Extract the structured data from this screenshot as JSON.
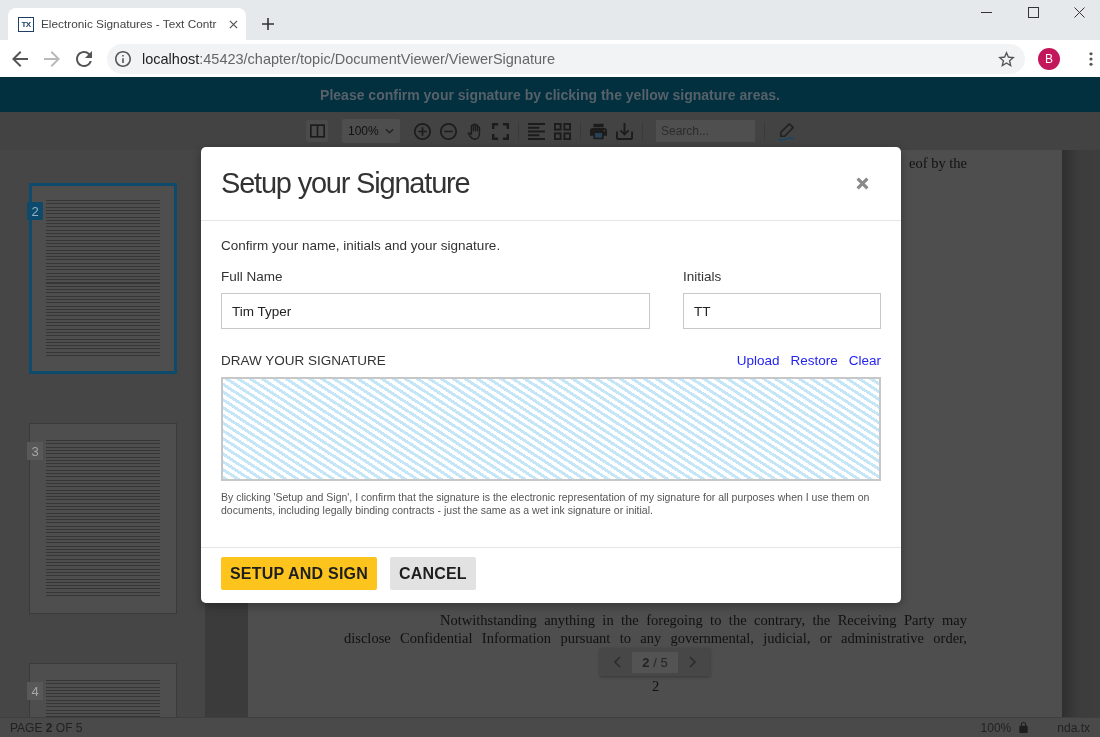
{
  "browser": {
    "tab": {
      "icon_text": "TX",
      "title": "Electronic Signatures - Text Contr",
      "selected": true
    },
    "address": {
      "host": "localhost",
      "path": ":45423/chapter/topic/DocumentViewer/ViewerSignature"
    },
    "profile": {
      "initial": "B"
    }
  },
  "banner": {
    "text": "Please confirm your signature by clicking the yellow signature areas."
  },
  "toolbar": {
    "zoom": "100%",
    "search": {
      "placeholder": "Search..."
    }
  },
  "thumbnails": [
    {
      "page": "2",
      "selected": true
    },
    {
      "page": "3",
      "selected": false
    },
    {
      "page": "4",
      "selected": false
    }
  ],
  "document": {
    "top_text": "eof by the",
    "paragraph": "Notwithstanding anything in the foregoing to the contrary, the Receiving Party may disclose Confidential Information pursuant to any governmental, judicial, or administrative order,",
    "page_number": "2"
  },
  "pager": {
    "label": "**2** / 5"
  },
  "dialog": {
    "title": "Setup your Signature",
    "intro": "Confirm your name, initials and your signature.",
    "fields": [
      {
        "label": "Full Name",
        "value": "Tim Typer"
      },
      {
        "label": "Initials",
        "value": "TT"
      }
    ],
    "signature": {
      "label": "DRAW YOUR SIGNATURE",
      "links": [
        "Upload",
        "Restore",
        "Clear"
      ]
    },
    "disclaimer": "By clicking 'Setup and Sign', I confirm that the signature is the electronic representation of my signature for all purposes when I use them on documents, including legally binding contracts - just the same as a wet ink signature or initial.",
    "buttons": [
      {
        "label": "SETUP AND SIGN",
        "kind": "primary"
      },
      {
        "label": "CANCEL",
        "kind": "secondary"
      }
    ]
  },
  "status_bar": {
    "page": "PAGE **2** OF 5",
    "zoom": "100%",
    "file": "nda.tx"
  }
}
